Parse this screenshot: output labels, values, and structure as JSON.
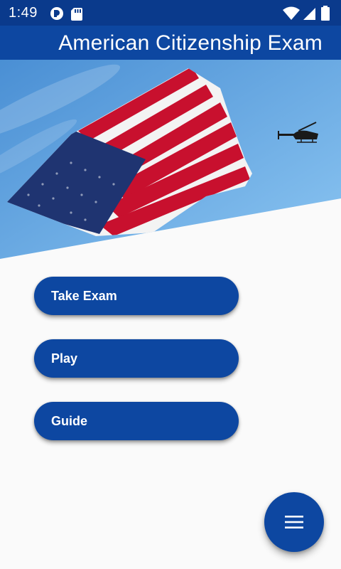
{
  "status_bar": {
    "time": "1:49",
    "icons_left": [
      "notification-app-icon",
      "sd-card-icon"
    ],
    "icons_right": [
      "wifi-icon",
      "cell-signal-icon",
      "battery-icon"
    ]
  },
  "app_bar": {
    "title": "American Citizenship Exam"
  },
  "hero": {
    "image": "american-flag-with-helicopter"
  },
  "menu": {
    "take_exam_label": "Take Exam",
    "play_label": "Play",
    "guide_label": "Guide"
  },
  "fab": {
    "icon": "menu-icon"
  },
  "colors": {
    "primary": "#0d47a1",
    "status_bar": "#0a3a8c",
    "background": "#fafafa",
    "sky": "#5fa8e8",
    "flag_red": "#c8102e",
    "flag_blue": "#1f3471"
  }
}
